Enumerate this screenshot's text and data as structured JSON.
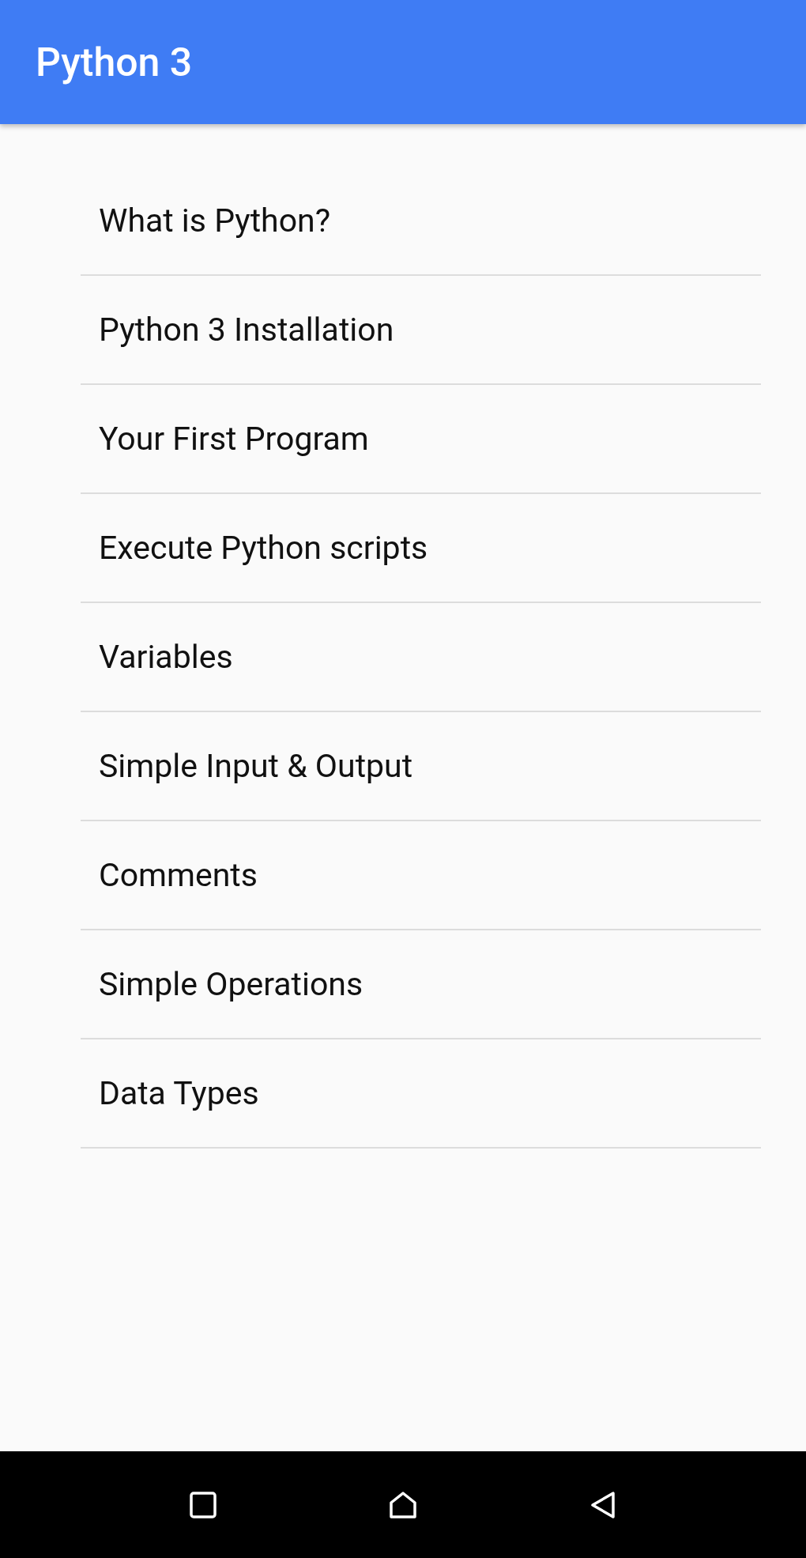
{
  "app_bar": {
    "title": "Python 3"
  },
  "items": [
    {
      "label": "What is Python?"
    },
    {
      "label": "Python 3 Installation"
    },
    {
      "label": "Your First Program"
    },
    {
      "label": "Execute Python scripts"
    },
    {
      "label": "Variables"
    },
    {
      "label": "Simple Input & Output"
    },
    {
      "label": "Comments"
    },
    {
      "label": "Simple Operations"
    },
    {
      "label": "Data Types"
    }
  ],
  "nav_bar": {
    "buttons": [
      {
        "kind": "recents"
      },
      {
        "kind": "home"
      },
      {
        "kind": "back"
      }
    ]
  }
}
